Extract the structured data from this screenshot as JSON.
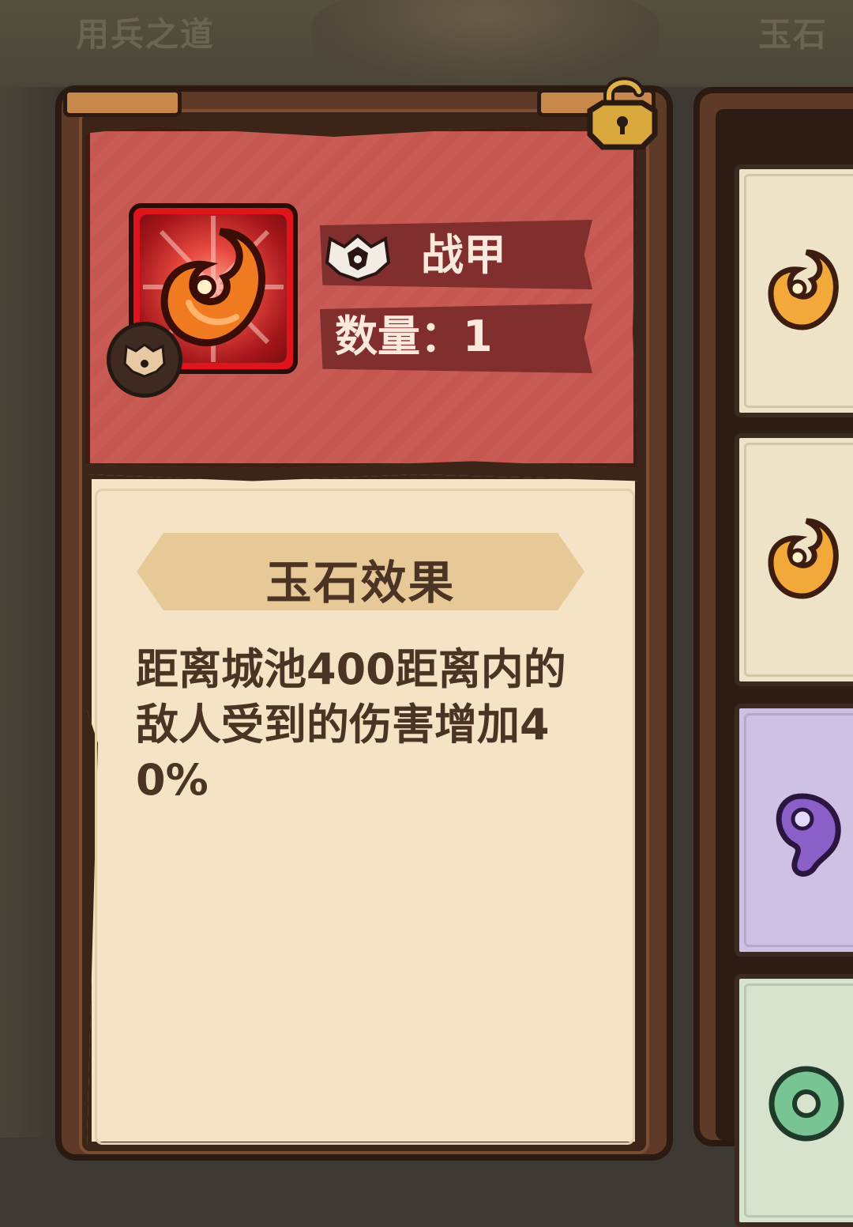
{
  "background": {
    "tab_left": "用兵之道",
    "tab_right": "玉石"
  },
  "item": {
    "icon": "orange-jade-icon",
    "type_icon": "armor-icon",
    "category": "战甲",
    "quantity_label": "数量：1",
    "lock_icon": "unlocked-padlock-icon",
    "effect_title": "玉石效果",
    "effect_text": "距离城池400距离内的敌人受到的伤害增加40%"
  },
  "side_list": [
    {
      "icon": "orange-jade-icon",
      "color": "#efe3c7"
    },
    {
      "icon": "orange-jade-icon",
      "color": "#efe3c7"
    },
    {
      "icon": "purple-jade-icon",
      "color": "#cfc1e4"
    },
    {
      "icon": "green-jade-ring-icon",
      "color": "#d7e3cc"
    }
  ],
  "colors": {
    "banner_red": "#c65750",
    "item_bg_red": "#e0141c",
    "parchment": "#f5e3c5",
    "frame_brown": "#5e3a27"
  }
}
